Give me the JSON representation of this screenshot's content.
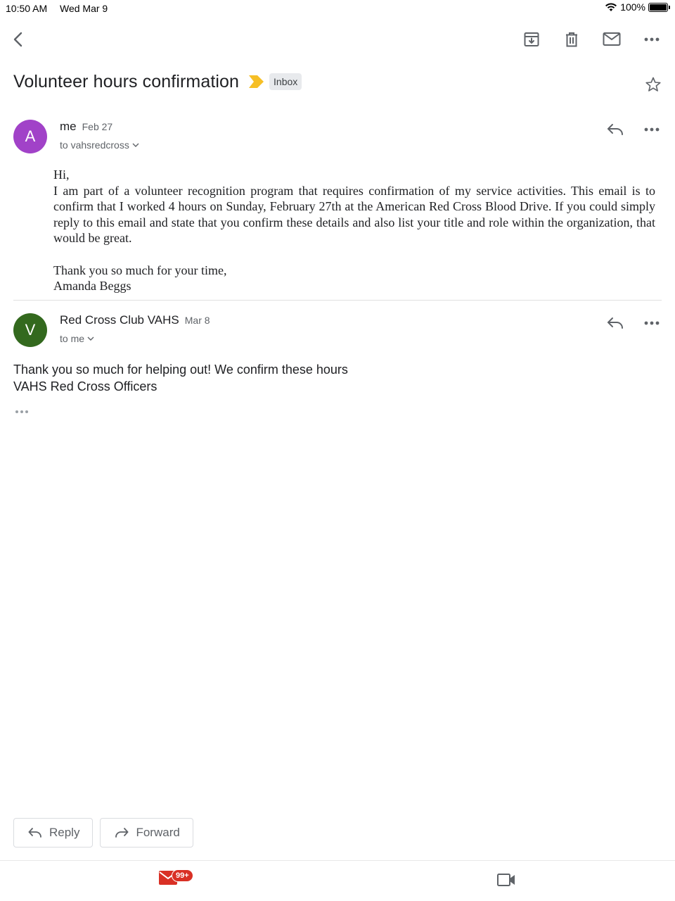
{
  "status": {
    "time": "10:50 AM",
    "date": "Wed Mar 9",
    "battery": "100%"
  },
  "thread": {
    "subject": "Volunteer hours confirmation",
    "label": "Inbox"
  },
  "messages": [
    {
      "avatar": "A",
      "avatar_color": "#a142c8",
      "sender": "me",
      "date": "Feb 27",
      "recipient": "to vahsredcross",
      "body": [
        "Hi,",
        "I am part of a volunteer recognition program that requires confirmation of my service activities. This email is to confirm that I worked 4 hours on Sunday, February 27th at the American Red Cross Blood Drive. If you could simply reply to this email and state that you confirm these details and also list your title and role within the organization, that would be great."
      ],
      "closing": [
        "Thank you so much for your time,",
        "Amanda Beggs"
      ]
    },
    {
      "avatar": "V",
      "avatar_color": "#33691e",
      "sender": "Red Cross Club VAHS",
      "date": "Mar 8",
      "recipient": "to me",
      "body": [
        "Thank you so much for helping out! We confirm these hours",
        "VAHS Red Cross Officers"
      ]
    }
  ],
  "actions": {
    "reply": "Reply",
    "forward": "Forward"
  },
  "bottom_nav": {
    "mail_badge": "99+"
  },
  "colors": {
    "accent_red": "#d93025",
    "label_yellow": "#f6bf26",
    "icon_gray": "#5f6368"
  }
}
